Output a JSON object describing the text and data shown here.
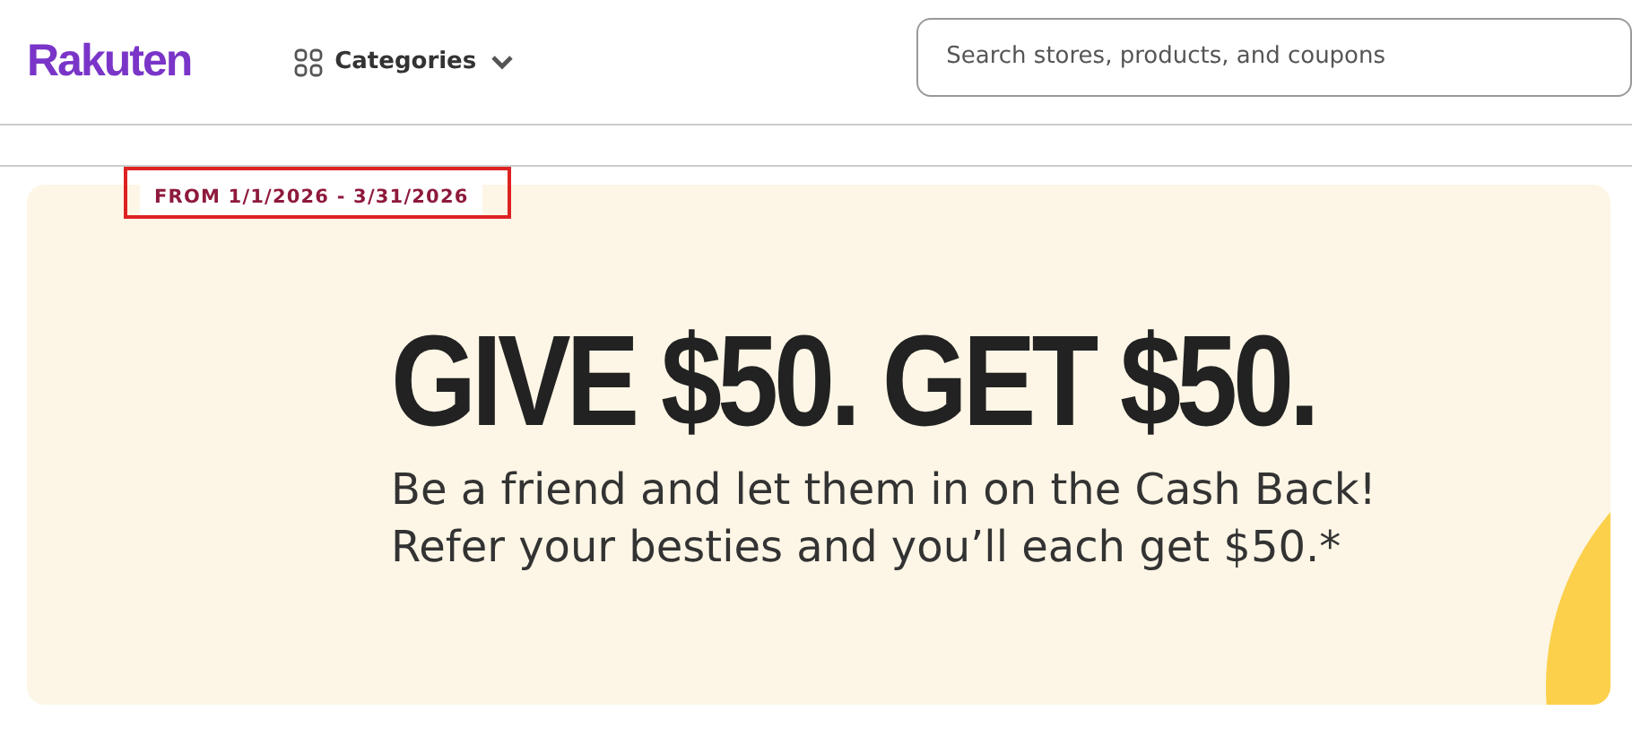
{
  "header": {
    "logo": "Rakuten",
    "categories": "Categories",
    "search": {
      "placeholder": "Search stores, products, and coupons"
    }
  },
  "banner": {
    "date_range": "FROM 1/1/2026 - 3/31/2026",
    "headline": "GIVE $50. GET $50.",
    "lines": [
      "Be a friend and let them in on the Cash Back!",
      "Refer your besties and you’ll each get $50.*"
    ]
  }
}
